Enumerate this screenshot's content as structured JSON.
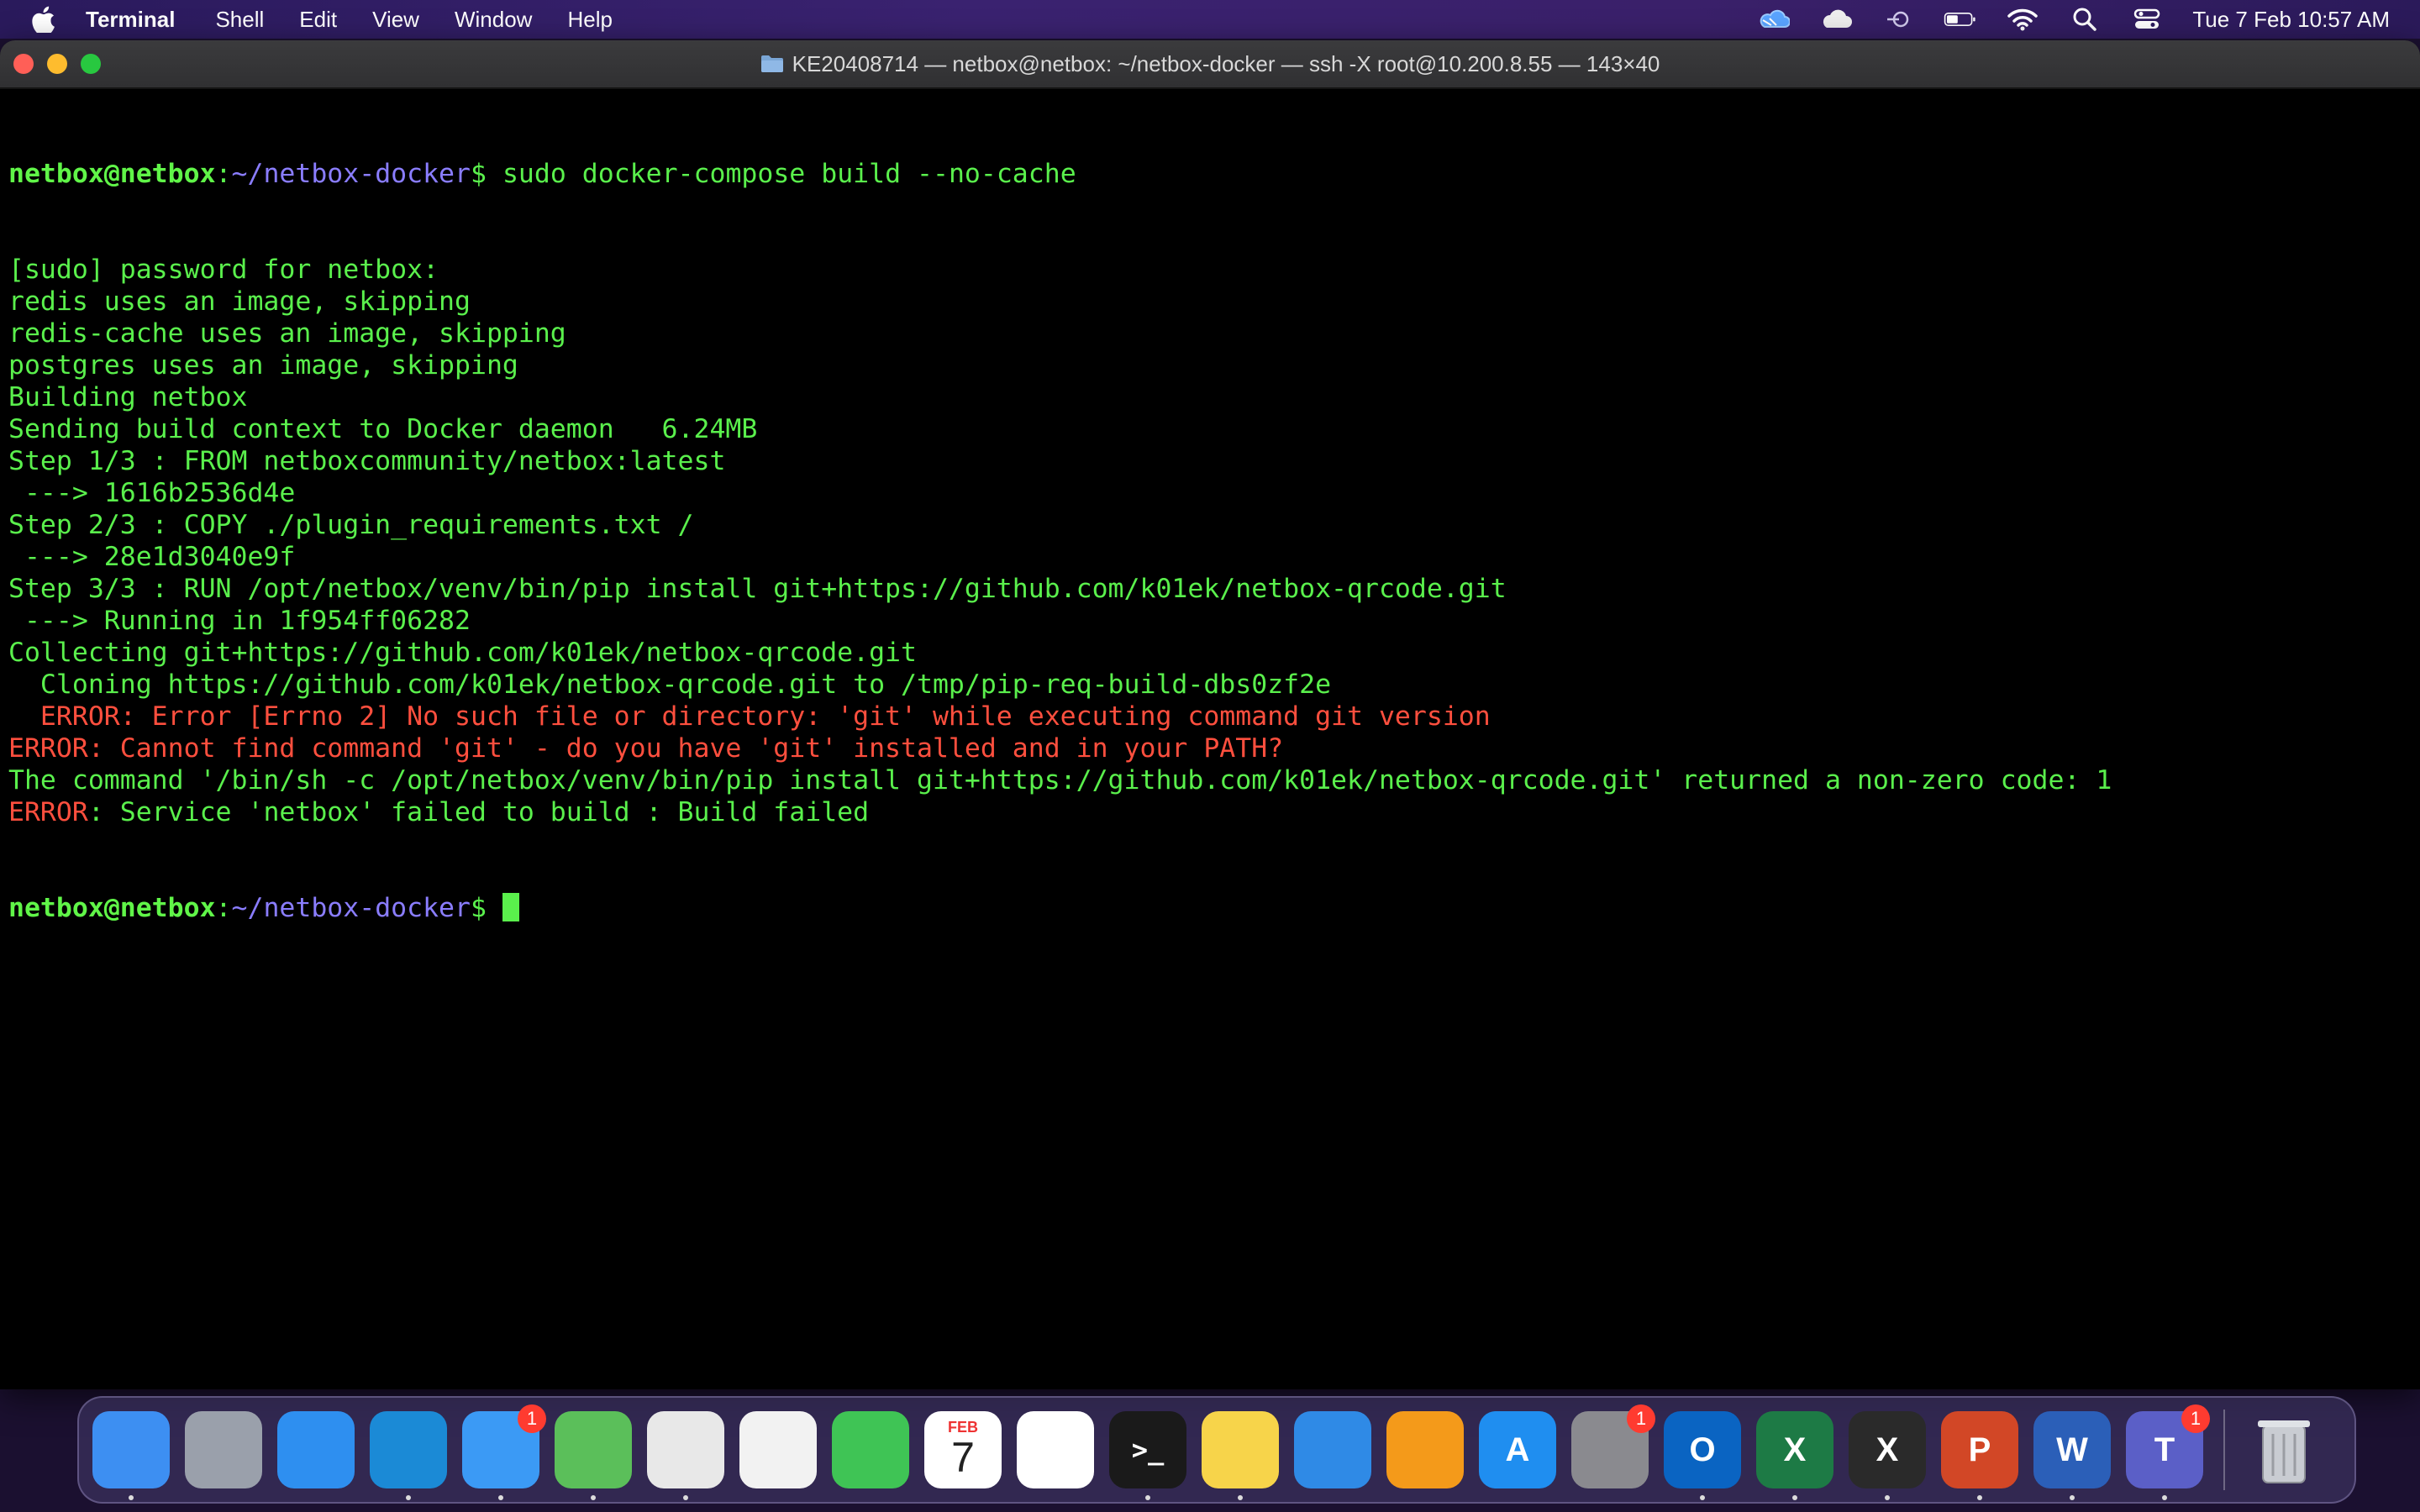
{
  "menubar": {
    "app_name": "Terminal",
    "menus": [
      "Shell",
      "Edit",
      "View",
      "Window",
      "Help"
    ],
    "clock": "Tue 7 Feb  10:57 AM",
    "status_icons": [
      "onedrive-icon",
      "icloud-icon",
      "vpn-icon",
      "battery-icon",
      "wifi-icon",
      "spotlight-icon",
      "control-center-icon"
    ]
  },
  "window": {
    "title": "KE20408714 — netbox@netbox: ~/netbox-docker — ssh -X root@10.200.8.55 — 143×40"
  },
  "terminal": {
    "prompt_user": "netbox@netbox",
    "prompt_sep": ":",
    "prompt_path": "~/netbox-docker",
    "prompt_symbol": "$ ",
    "command": "sudo docker-compose build --no-cache",
    "lines": [
      {
        "text": "[sudo] password for netbox:",
        "error": false
      },
      {
        "text": "redis uses an image, skipping",
        "error": false
      },
      {
        "text": "redis-cache uses an image, skipping",
        "error": false
      },
      {
        "text": "postgres uses an image, skipping",
        "error": false
      },
      {
        "text": "Building netbox",
        "error": false
      },
      {
        "text": "Sending build context to Docker daemon   6.24MB",
        "error": false
      },
      {
        "text": "Step 1/3 : FROM netboxcommunity/netbox:latest",
        "error": false
      },
      {
        "text": " ---> 1616b2536d4e",
        "error": false
      },
      {
        "text": "Step 2/3 : COPY ./plugin_requirements.txt /",
        "error": false
      },
      {
        "text": " ---> 28e1d3040e9f",
        "error": false
      },
      {
        "text": "Step 3/3 : RUN /opt/netbox/venv/bin/pip install git+https://github.com/k01ek/netbox-qrcode.git",
        "error": false
      },
      {
        "text": " ---> Running in 1f954ff06282",
        "error": false
      },
      {
        "text": "Collecting git+https://github.com/k01ek/netbox-qrcode.git",
        "error": false
      },
      {
        "text": "  Cloning https://github.com/k01ek/netbox-qrcode.git to /tmp/pip-req-build-dbs0zf2e",
        "error": false
      },
      {
        "text": "  ERROR: Error [Errno 2] No such file or directory: 'git' while executing command git version",
        "error": true
      },
      {
        "text": "ERROR: Cannot find command 'git' - do you have 'git' installed and in your PATH?",
        "error": true
      },
      {
        "text": "The command '/bin/sh -c /opt/netbox/venv/bin/pip install git+https://github.com/k01ek/netbox-qrcode.git' returned a non-zero code: 1",
        "error": false
      },
      {
        "text_error": "ERROR",
        "text": ": Service 'netbox' failed to build : Build failed",
        "error": "prefix"
      }
    ]
  },
  "dock": {
    "apps": [
      {
        "name": "finder",
        "label": "",
        "color": "#3d8ff2",
        "badge": "",
        "running": true
      },
      {
        "name": "launchpad",
        "label": "",
        "color": "#9aa0ab",
        "badge": "",
        "running": false
      },
      {
        "name": "safari",
        "label": "",
        "color": "#2e8ff0",
        "badge": "",
        "running": false
      },
      {
        "name": "edge",
        "label": "",
        "color": "#1b8ad6",
        "badge": "",
        "running": true
      },
      {
        "name": "mail",
        "label": "",
        "color": "#3b9af5",
        "badge": "1",
        "running": true
      },
      {
        "name": "maps",
        "label": "",
        "color": "#5bbf5a",
        "badge": "",
        "running": true
      },
      {
        "name": "chrome",
        "label": "",
        "color": "#e8e8e8",
        "badge": "",
        "running": true
      },
      {
        "name": "photos",
        "label": "",
        "color": "#f2f2f2",
        "badge": "",
        "running": false
      },
      {
        "name": "facetime",
        "label": "",
        "color": "#3fc455",
        "badge": "",
        "running": false
      },
      {
        "name": "calendar",
        "label": "7",
        "month": "FEB",
        "color": "#ffffff",
        "badge": "",
        "running": false
      },
      {
        "name": "reminders",
        "label": "",
        "color": "#ffffff",
        "badge": "",
        "running": false
      },
      {
        "name": "terminal",
        "label": ">_",
        "color": "#1a1a1a",
        "badge": "",
        "running": true
      },
      {
        "name": "notes",
        "label": "",
        "color": "#f7d44a",
        "badge": "",
        "running": true
      },
      {
        "name": "keynote",
        "label": "",
        "color": "#2f8ae6",
        "badge": "",
        "running": false
      },
      {
        "name": "pages",
        "label": "",
        "color": "#f49a1a",
        "badge": "",
        "running": false
      },
      {
        "name": "app-store",
        "label": "A",
        "color": "#1f8ef0",
        "badge": "",
        "running": false
      },
      {
        "name": "system-preferences",
        "label": "",
        "color": "#8a8a8f",
        "badge": "1",
        "running": false
      },
      {
        "name": "outlook",
        "label": "O",
        "color": "#0a64c2",
        "badge": "",
        "running": true
      },
      {
        "name": "excel",
        "label": "X",
        "color": "#1d7a45",
        "badge": "",
        "running": true
      },
      {
        "name": "xquartz",
        "label": "X",
        "color": "#2a2a2a",
        "badge": "",
        "running": true
      },
      {
        "name": "powerpoint",
        "label": "P",
        "color": "#d24726",
        "badge": "",
        "running": true
      },
      {
        "name": "word",
        "label": "W",
        "color": "#2b5fb8",
        "badge": "",
        "running": true
      },
      {
        "name": "teams",
        "label": "T",
        "color": "#5b5fc7",
        "badge": "1",
        "running": true
      }
    ],
    "trash": {
      "name": "trash"
    }
  }
}
